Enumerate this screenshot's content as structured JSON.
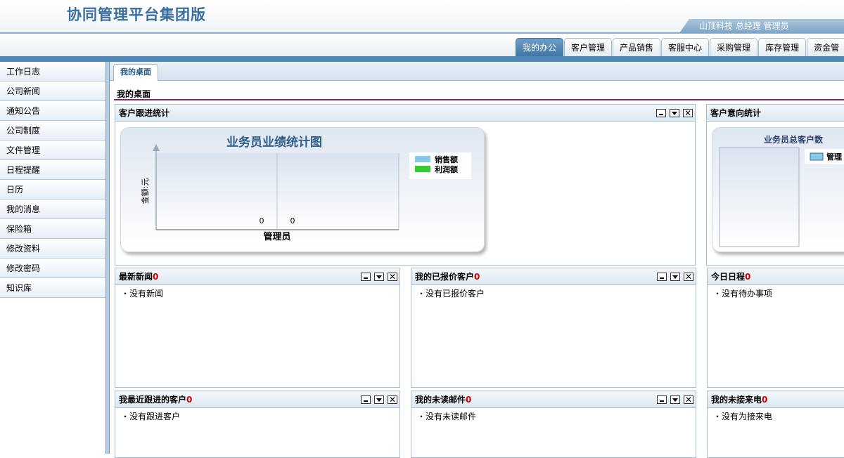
{
  "header": {
    "app_title": "协同管理平台集团版",
    "user_info": "山顶科技 总经理 管理员"
  },
  "nav": {
    "tabs": [
      {
        "label": "我的办公",
        "active": true
      },
      {
        "label": "客户管理"
      },
      {
        "label": "产品销售"
      },
      {
        "label": "客服中心"
      },
      {
        "label": "采购管理"
      },
      {
        "label": "库存管理"
      },
      {
        "label": "资金管"
      }
    ]
  },
  "sidebar": {
    "items": [
      "工作日志",
      "公司新闻",
      "通知公告",
      "公司制度",
      "文件管理",
      "日程提醒",
      "日历",
      "我的消息",
      "保险箱",
      "修改资料",
      "修改密码",
      "知识库"
    ]
  },
  "content": {
    "tab_label": "我的桌面",
    "desk_title": "我的桌面"
  },
  "panels": {
    "follow_stats": {
      "title": "客户跟进统计"
    },
    "intent_stats": {
      "title": "客户意向统计"
    },
    "news": {
      "title": "最新新闻",
      "count": "0",
      "empty": "・没有新闻"
    },
    "quoted": {
      "title": "我的已报价客户",
      "count": "0",
      "empty": "・没有已报价客户"
    },
    "schedule": {
      "title": "今日日程",
      "count": "0",
      "empty": "・没有待办事项"
    },
    "recent_follow": {
      "title": "我最近跟进的客户",
      "count": "0",
      "empty": "・没有跟进客户"
    },
    "unread_mail": {
      "title": "我的未读邮件",
      "count": "0",
      "empty": "・没有未读邮件"
    },
    "missed_calls": {
      "title": "我的未接来电",
      "count": "0",
      "empty": "・没有为接来电"
    }
  },
  "chart_data": [
    {
      "type": "bar",
      "title": "业务员业绩统计图",
      "xlabel": "管理员",
      "ylabel": "金额:元",
      "categories": [
        "管理员"
      ],
      "series": [
        {
          "name": "销售额",
          "values": [
            0
          ],
          "color": "#87c9e8"
        },
        {
          "name": "利润额",
          "values": [
            0
          ],
          "color": "#33cc33"
        }
      ],
      "value_labels": [
        "0",
        "0"
      ],
      "legend": "right"
    },
    {
      "type": "bar",
      "title": "业务员总客户数",
      "series": [
        {
          "name": "管理",
          "values": [],
          "color": "#87c9e8"
        }
      ],
      "legend": "right"
    }
  ]
}
